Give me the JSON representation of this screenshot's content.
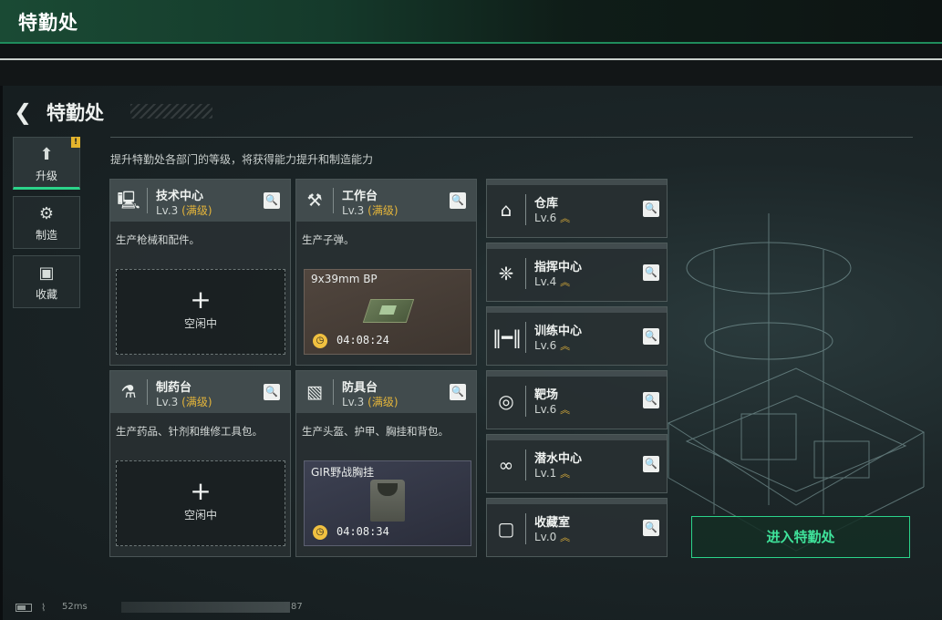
{
  "window": {
    "title": "特勤处"
  },
  "header": {
    "title": "特勤处",
    "back_icon": "back-arrow-icon"
  },
  "sidebar": {
    "tabs": [
      {
        "label": "升级",
        "icon": "upgrade-icon",
        "active": true,
        "badge": "!"
      },
      {
        "label": "制造",
        "icon": "gears-icon",
        "active": false
      },
      {
        "label": "收藏",
        "icon": "collection-icon",
        "active": false
      }
    ]
  },
  "description": "提升特勤处各部门的等级，将获得能力提升和制造能力",
  "workshops": [
    {
      "name": "技术中心",
      "level": "Lv.3",
      "max": "(满级)",
      "icon": "computer-icon",
      "desc": "生产枪械和配件。",
      "slot": {
        "state": "idle",
        "label": "空闲中"
      }
    },
    {
      "name": "工作台",
      "level": "Lv.3",
      "max": "(满级)",
      "icon": "tools-icon",
      "desc": "生产子弹。",
      "slot": {
        "state": "producing",
        "item": "9x39mm BP",
        "time": "04:08:24"
      }
    },
    {
      "name": "制药台",
      "level": "Lv.3",
      "max": "(满级)",
      "icon": "microscope-icon",
      "desc": "生产药品、针剂和维修工具包。",
      "slot": {
        "state": "idle",
        "label": "空闲中"
      }
    },
    {
      "name": "防具台",
      "level": "Lv.3",
      "max": "(满级)",
      "icon": "armor-blocks-icon",
      "desc": "生产头盔、护甲、胸挂和背包。",
      "slot": {
        "state": "producing",
        "item": "GIR野战胸挂",
        "time": "04:08:34"
      }
    }
  ],
  "facilities": [
    {
      "name": "仓库",
      "level": "Lv.6",
      "icon": "warehouse-icon"
    },
    {
      "name": "指挥中心",
      "level": "Lv.4",
      "icon": "command-center-icon"
    },
    {
      "name": "训练中心",
      "level": "Lv.6",
      "icon": "dumbbell-icon"
    },
    {
      "name": "靶场",
      "level": "Lv.6",
      "icon": "target-icon"
    },
    {
      "name": "潜水中心",
      "level": "Lv.1",
      "icon": "diving-mask-icon"
    },
    {
      "name": "收藏室",
      "level": "Lv.0",
      "icon": "collection-room-icon"
    }
  ],
  "upgrade_glyph": "︽",
  "search_glyph": "🔍",
  "enter_button": "进入特勤处",
  "status": {
    "ping": "52ms",
    "uid_tail": "87"
  },
  "colors": {
    "accent_green": "#2bd48a",
    "max_level_gold": "#e5b53a"
  }
}
